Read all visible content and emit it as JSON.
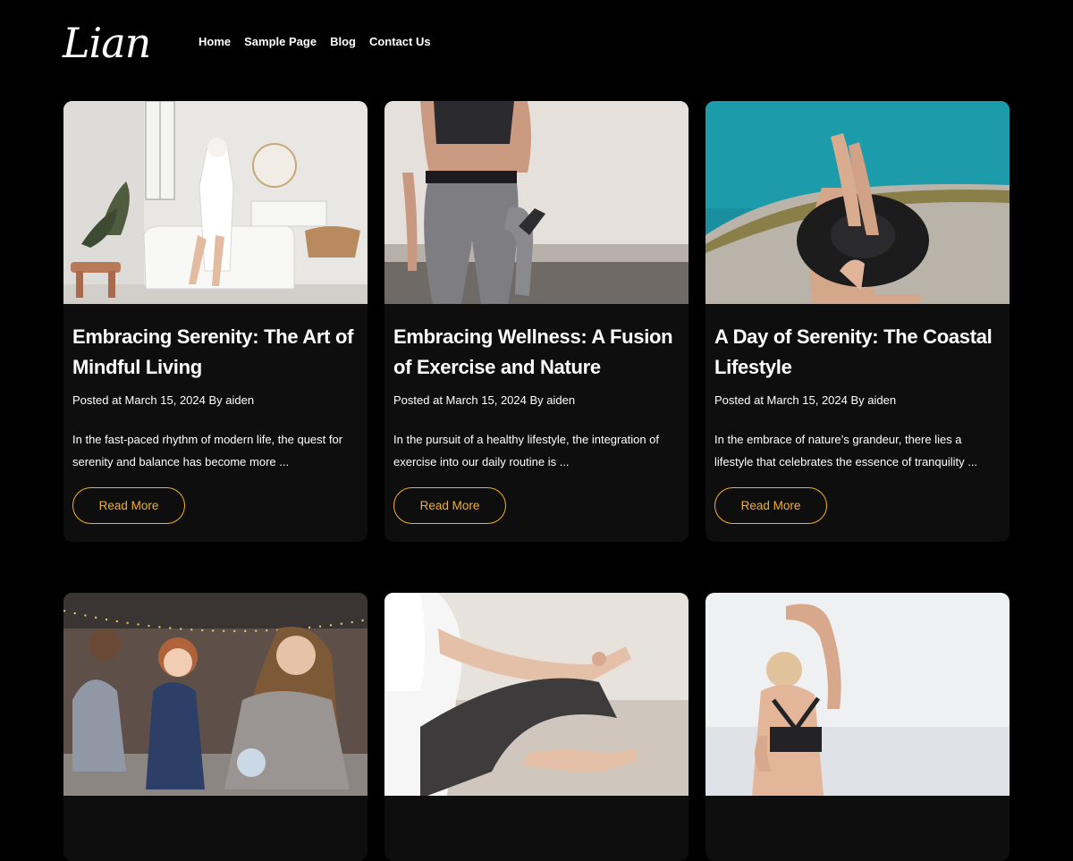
{
  "site": {
    "logo_text": "Lian"
  },
  "nav": {
    "items": [
      {
        "label": "Home"
      },
      {
        "label": "Sample Page"
      },
      {
        "label": "Blog"
      },
      {
        "label": "Contact Us"
      }
    ]
  },
  "colors": {
    "background": "#000000",
    "card_background": "#0e0e0e",
    "accent": "#f2b127",
    "text": "#ffffff"
  },
  "posts": [
    {
      "image": "woman-in-bathrobe-bathroom-photo",
      "title": "Embracing Serenity: The Art of Mindful Living",
      "meta": "Posted at March 15, 2024 By aiden",
      "excerpt": "In the fast-paced rhythm of modern life, the quest for serenity and balance has become more ...",
      "button": "Read More"
    },
    {
      "image": "woman-exercising-on-beach-photo",
      "title": "Embracing Wellness: A Fusion of Exercise and Nature",
      "meta": "Posted at March 15, 2024 By aiden",
      "excerpt": "In the pursuit of a healthy lifestyle, the integration of exercise into our daily routine is ...",
      "button": "Read More"
    },
    {
      "image": "woman-with-hat-on-coastal-rock-photo",
      "title": "A Day of Serenity: The Coastal Lifestyle",
      "meta": "Posted at March 15, 2024 By aiden",
      "excerpt": "In the embrace of nature’s grandeur, there lies a lifestyle that celebrates the essence of tranquility ...",
      "button": "Read More"
    },
    {
      "image": "family-with-string-lights-photo"
    },
    {
      "image": "woman-meditating-photo"
    },
    {
      "image": "woman-stretching-by-sea-photo"
    }
  ]
}
